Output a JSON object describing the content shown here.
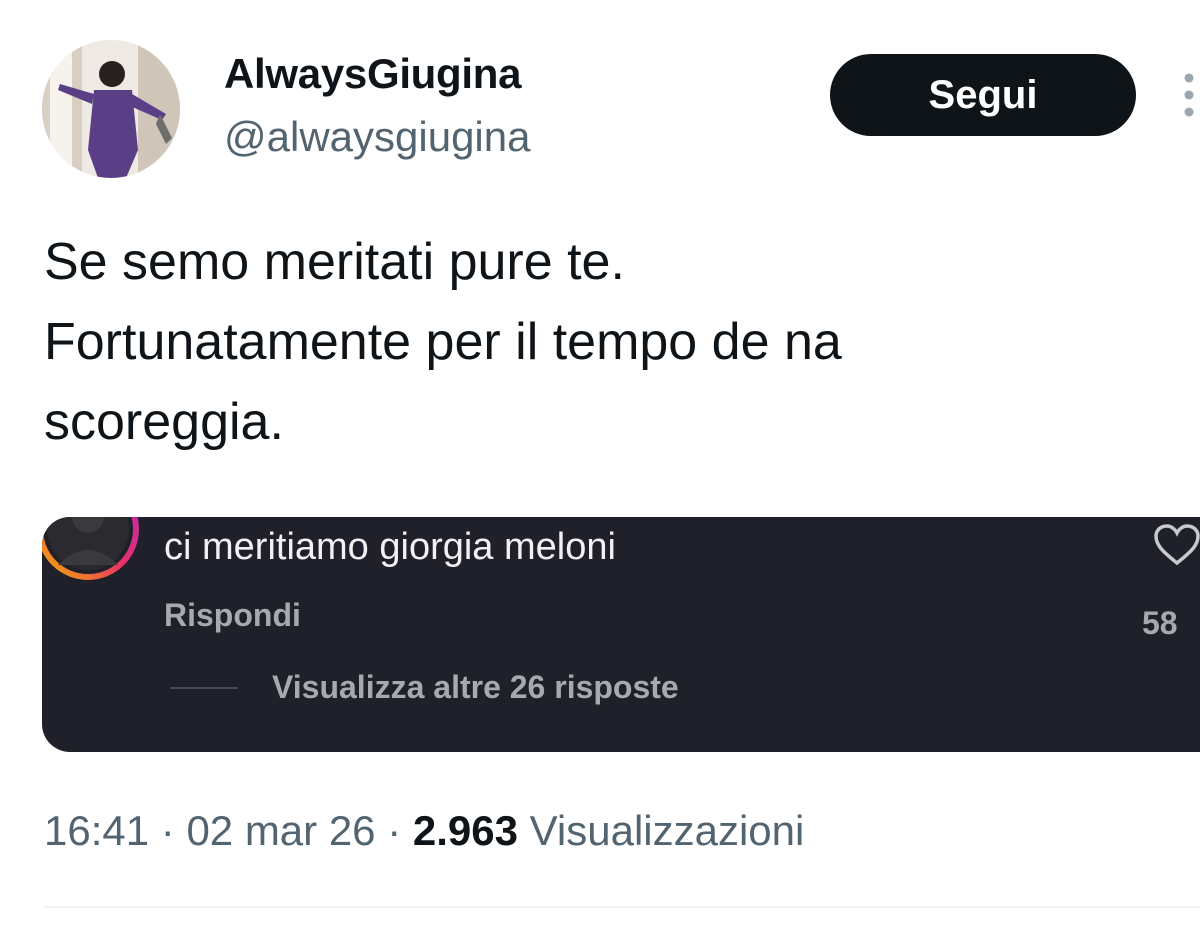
{
  "tweet": {
    "author": {
      "display_name": "AlwaysGiugina",
      "handle": "@alwaysgiugina",
      "avatar_icon": "profile-photo"
    },
    "follow_label": "Segui",
    "more_icon": "more-vertical-icon",
    "text_lines": [
      "Se semo meritati pure te.",
      "Fortunatamente per il tempo de na",
      "scoreggia."
    ],
    "media": {
      "comment_text": "ci meritiamo giorgia meloni",
      "reply_label": "Rispondi",
      "like_count": "58",
      "like_icon": "heart-outline-icon",
      "view_replies_label": "Visualizza altre 26 risposte"
    },
    "meta": {
      "time": "16:41",
      "separator": " · ",
      "date": "02 mar 26",
      "views_count": "2.963",
      "views_label": "Visualizzazioni"
    }
  },
  "colors": {
    "text_primary": "#0f1419",
    "text_secondary": "#536471",
    "button_bg": "#0f1419",
    "media_bg": "#1f2029"
  }
}
